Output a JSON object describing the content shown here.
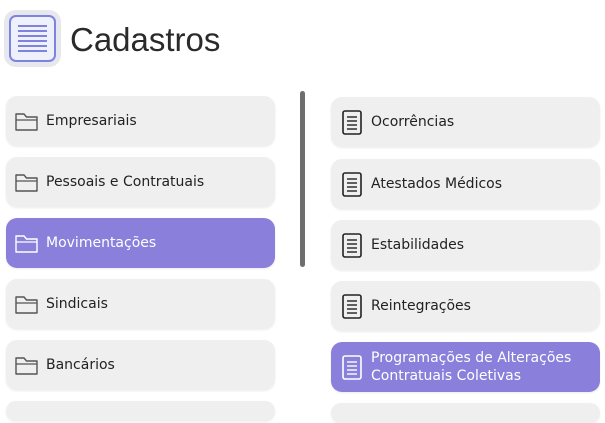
{
  "header": {
    "title": "Cadastros",
    "icon": "list-document-icon",
    "accent_color": "#8a80dc"
  },
  "left_menu": {
    "items": [
      {
        "label": "Empresariais",
        "icon": "folder-icon",
        "active": false
      },
      {
        "label": "Pessoais e Contratuais",
        "icon": "folder-icon",
        "active": false
      },
      {
        "label": "Movimentações",
        "icon": "folder-icon",
        "active": true
      },
      {
        "label": "Sindicais",
        "icon": "folder-icon",
        "active": false
      },
      {
        "label": "Bancários",
        "icon": "folder-icon",
        "active": false
      }
    ]
  },
  "right_menu": {
    "items": [
      {
        "label": "Ocorrências",
        "icon": "document-icon",
        "active": false
      },
      {
        "label": "Atestados Médicos",
        "icon": "document-icon",
        "active": false
      },
      {
        "label": "Estabilidades",
        "icon": "document-icon",
        "active": false
      },
      {
        "label": "Reintegrações",
        "icon": "document-icon",
        "active": false
      },
      {
        "label": "Programações de Alterações Contratuais Coletivas",
        "icon": "document-icon",
        "active": true
      }
    ]
  }
}
